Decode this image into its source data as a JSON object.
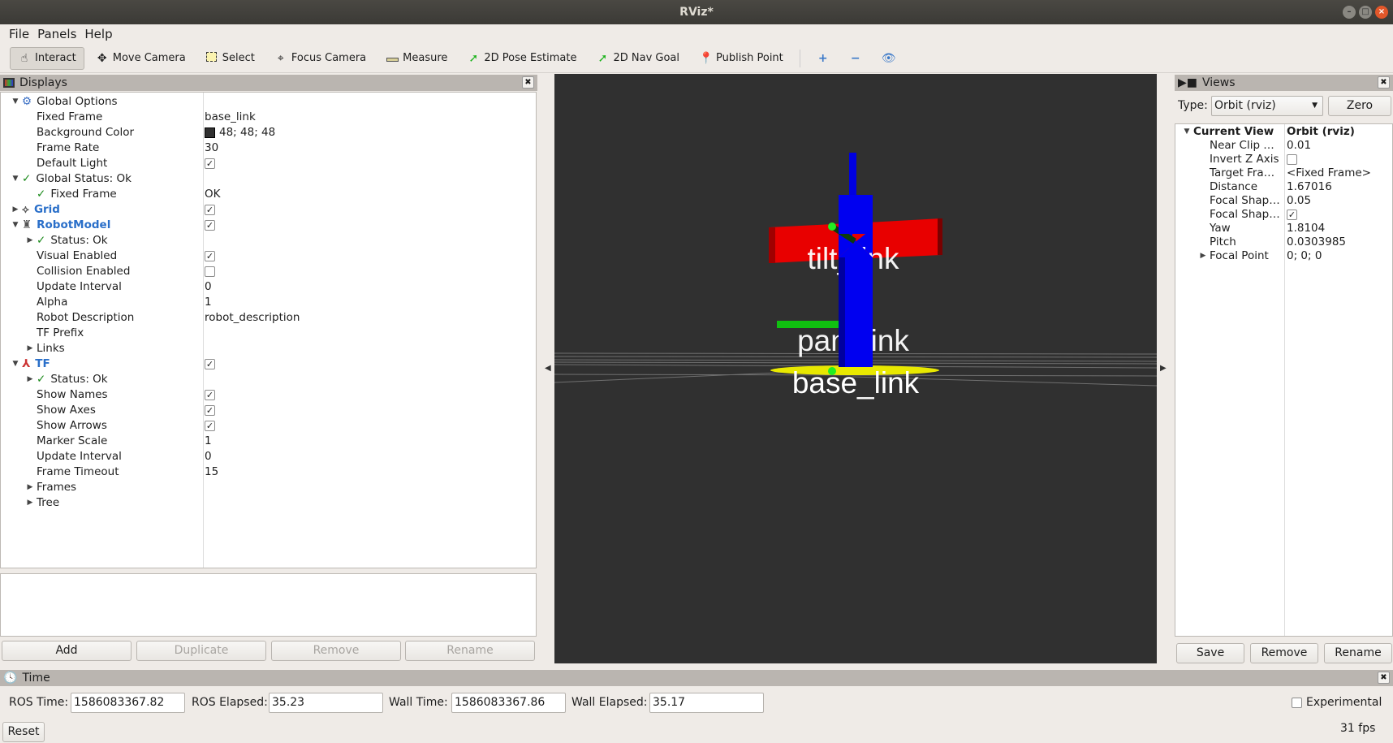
{
  "window": {
    "title": "RViz*"
  },
  "menu": [
    "File",
    "Panels",
    "Help"
  ],
  "toolbar": {
    "tools": [
      {
        "label": "Interact",
        "icon": "hand-icon",
        "active": true
      },
      {
        "label": "Move Camera",
        "icon": "move-camera-icon"
      },
      {
        "label": "Select",
        "icon": "select-icon"
      },
      {
        "label": "Focus Camera",
        "icon": "focus-camera-icon"
      },
      {
        "label": "Measure",
        "icon": "ruler-icon"
      },
      {
        "label": "2D Pose Estimate",
        "icon": "green-arrow-icon"
      },
      {
        "label": "2D Nav Goal",
        "icon": "green-arrow-icon"
      },
      {
        "label": "Publish Point",
        "icon": "map-pin-icon"
      }
    ]
  },
  "displays": {
    "title": "Displays",
    "rows": [
      {
        "label": "Global Options",
        "level": 0,
        "arrow": "open",
        "icon": "gear-icon"
      },
      {
        "label": "Fixed Frame",
        "level": 1,
        "value": "base_link"
      },
      {
        "label": "Background Color",
        "level": 1,
        "value": "48; 48; 48",
        "swatch": "#303030"
      },
      {
        "label": "Frame Rate",
        "level": 1,
        "value": "30"
      },
      {
        "label": "Default Light",
        "level": 1,
        "check": true
      },
      {
        "label": "Global Status: Ok",
        "level": 0,
        "arrow": "open",
        "ok": true
      },
      {
        "label": "Fixed Frame",
        "level": 1,
        "ok": true,
        "value": "OK"
      },
      {
        "label": "Grid",
        "level": 0,
        "arrow": "closed",
        "icon": "grid-icon",
        "blue": true,
        "check": true
      },
      {
        "label": "RobotModel",
        "level": 0,
        "arrow": "open",
        "icon": "robot-icon",
        "blue": true,
        "check": true
      },
      {
        "label": "Status: Ok",
        "level": 1,
        "arrow": "closed",
        "ok": true
      },
      {
        "label": "Visual Enabled",
        "level": 1,
        "check": true
      },
      {
        "label": "Collision Enabled",
        "level": 1,
        "check": false
      },
      {
        "label": "Update Interval",
        "level": 1,
        "value": "0"
      },
      {
        "label": "Alpha",
        "level": 1,
        "value": "1"
      },
      {
        "label": "Robot Description",
        "level": 1,
        "value": "robot_description"
      },
      {
        "label": "TF Prefix",
        "level": 1
      },
      {
        "label": "Links",
        "level": 1,
        "arrow": "closed"
      },
      {
        "label": "TF",
        "level": 0,
        "arrow": "open",
        "icon": "tf-axes-icon",
        "blue": true,
        "check": true
      },
      {
        "label": "Status: Ok",
        "level": 1,
        "arrow": "closed",
        "ok": true
      },
      {
        "label": "Show Names",
        "level": 1,
        "check": true
      },
      {
        "label": "Show Axes",
        "level": 1,
        "check": true
      },
      {
        "label": "Show Arrows",
        "level": 1,
        "check": true
      },
      {
        "label": "Marker Scale",
        "level": 1,
        "value": "1"
      },
      {
        "label": "Update Interval",
        "level": 1,
        "value": "0"
      },
      {
        "label": "Frame Timeout",
        "level": 1,
        "value": "15"
      },
      {
        "label": "Frames",
        "level": 1,
        "arrow": "closed"
      },
      {
        "label": "Tree",
        "level": 1,
        "arrow": "closed"
      }
    ],
    "buttons": {
      "add": "Add",
      "duplicate": "Duplicate",
      "remove": "Remove",
      "rename": "Rename"
    }
  },
  "scene": {
    "labels": {
      "tilt": "tilt_link",
      "pan": "pan_link",
      "base": "base_link"
    }
  },
  "views": {
    "title": "Views",
    "type_label": "Type:",
    "type_value": "Orbit (rviz)",
    "zero": "Zero",
    "rows": [
      {
        "label": "Current View",
        "value": "Orbit (rviz)",
        "bold": true,
        "arrow": "open",
        "level": 0
      },
      {
        "label": "Near Clip …",
        "value": "0.01",
        "level": 1
      },
      {
        "label": "Invert Z Axis",
        "check": false,
        "level": 1
      },
      {
        "label": "Target Fra…",
        "value": "<Fixed Frame>",
        "level": 1
      },
      {
        "label": "Distance",
        "value": "1.67016",
        "level": 1
      },
      {
        "label": "Focal Shap…",
        "value": "0.05",
        "level": 1
      },
      {
        "label": "Focal Shap…",
        "check": true,
        "level": 1
      },
      {
        "label": "Yaw",
        "value": "1.8104",
        "level": 1
      },
      {
        "label": "Pitch",
        "value": "0.0303985",
        "level": 1
      },
      {
        "label": "Focal Point",
        "value": "0; 0; 0",
        "arrow": "closed",
        "level": 1
      }
    ],
    "buttons": {
      "save": "Save",
      "remove": "Remove",
      "rename": "Rename"
    }
  },
  "time": {
    "title": "Time",
    "ros_time_label": "ROS Time:",
    "ros_time": "1586083367.82",
    "ros_elapsed_label": "ROS Elapsed:",
    "ros_elapsed": "35.23",
    "wall_time_label": "Wall Time:",
    "wall_time": "1586083367.86",
    "wall_elapsed_label": "Wall Elapsed:",
    "wall_elapsed": "35.17",
    "experimental": "Experimental",
    "reset": "Reset",
    "fps": "31 fps"
  }
}
